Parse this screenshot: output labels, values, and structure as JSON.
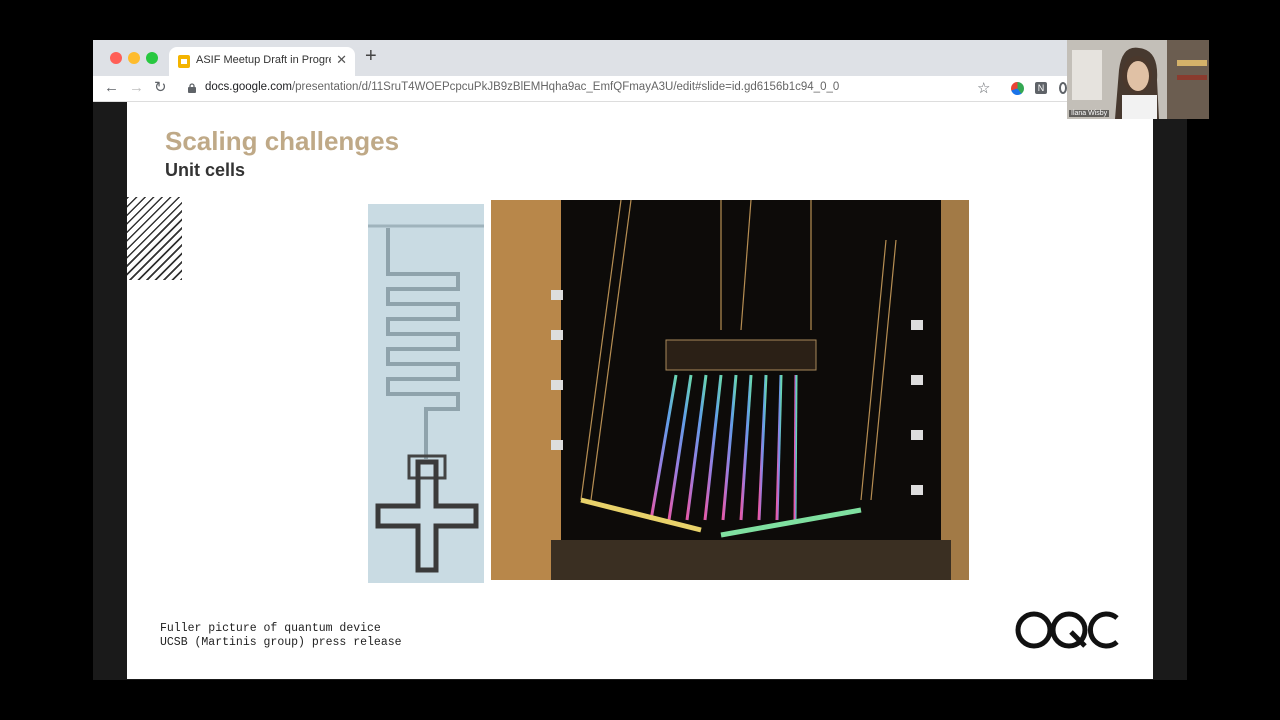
{
  "browser": {
    "tab_title": "ASIF Meetup Draft in Progress",
    "url_domain": "docs.google.com",
    "url_path": "/presentation/d/11SruT4WOEPcpcuPkJB9zBlEMHqha9ac_EmfQFmayA3U/edit#slide=id.gd6156b1c94_0_0"
  },
  "slide": {
    "title": "Scaling challenges",
    "subtitle": "Unit cells",
    "caption_line1": "Fuller picture of quantum device",
    "caption_line2": "UCSB (Martinis group) press release",
    "logo_text": "OQC"
  },
  "webcam": {
    "participant_name": "Ilana Wisby"
  },
  "colors": {
    "title": "#bfa987",
    "tab_strip": "#dee1e6",
    "favicon": "#f4b400"
  }
}
